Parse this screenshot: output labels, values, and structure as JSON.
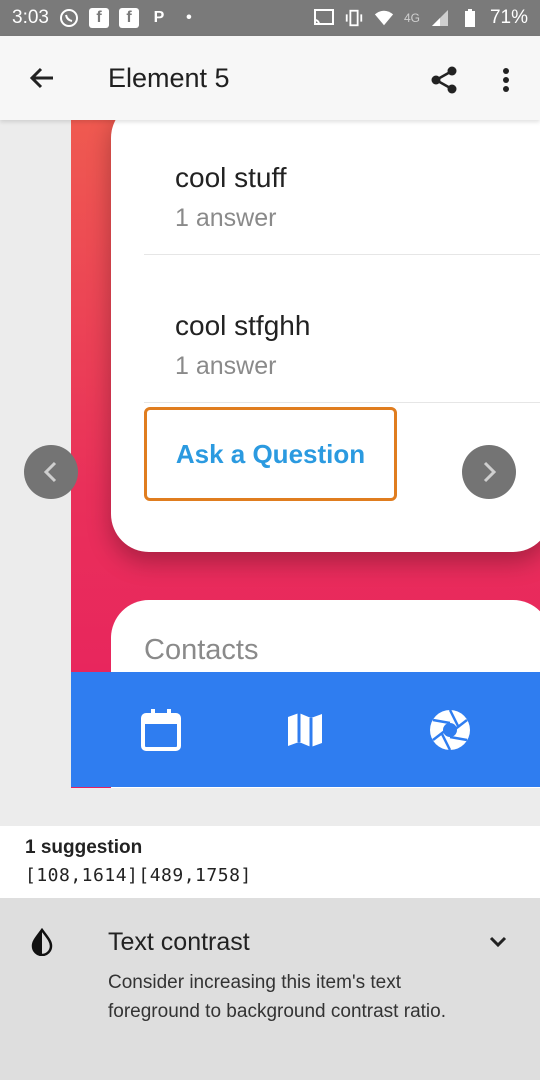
{
  "status_bar": {
    "time": "3:03",
    "network": "4G",
    "battery": "71%",
    "icons": [
      "whatsapp-icon",
      "facebook-icon",
      "facebook-icon",
      "parking-icon",
      "dot-icon",
      "cast-icon",
      "vibrate-icon",
      "wifi-icon",
      "signal-icon",
      "battery-icon"
    ]
  },
  "app_bar": {
    "title": "Element 5",
    "back_icon": "arrow-back-icon",
    "share_icon": "share-icon",
    "more_icon": "more-vert-icon"
  },
  "preview": {
    "questions": [
      {
        "title": "cool stuff",
        "subtitle": "1 answer"
      },
      {
        "title": "cool stfghh",
        "subtitle": "1 answer"
      }
    ],
    "ask_button_label": "Ask a Question",
    "contacts_title": "Contacts",
    "tabs": [
      "calendar-icon",
      "map-icon",
      "camera-aperture-icon"
    ],
    "colors": {
      "gradient_top": "#ef5a50",
      "gradient_bottom": "#e8205f",
      "tabbar": "#2f7df0",
      "link_blue": "#2b9ae0",
      "highlight_orange": "#e07d1f"
    }
  },
  "suggestion": {
    "count_label": "1 suggestion",
    "bounds": "[108,1614][489,1758]"
  },
  "issue": {
    "title": "Text contrast",
    "description": "Consider increasing this item's text foreground to background contrast ratio.",
    "icon": "contrast-icon",
    "expand_icon": "chevron-down-icon"
  }
}
